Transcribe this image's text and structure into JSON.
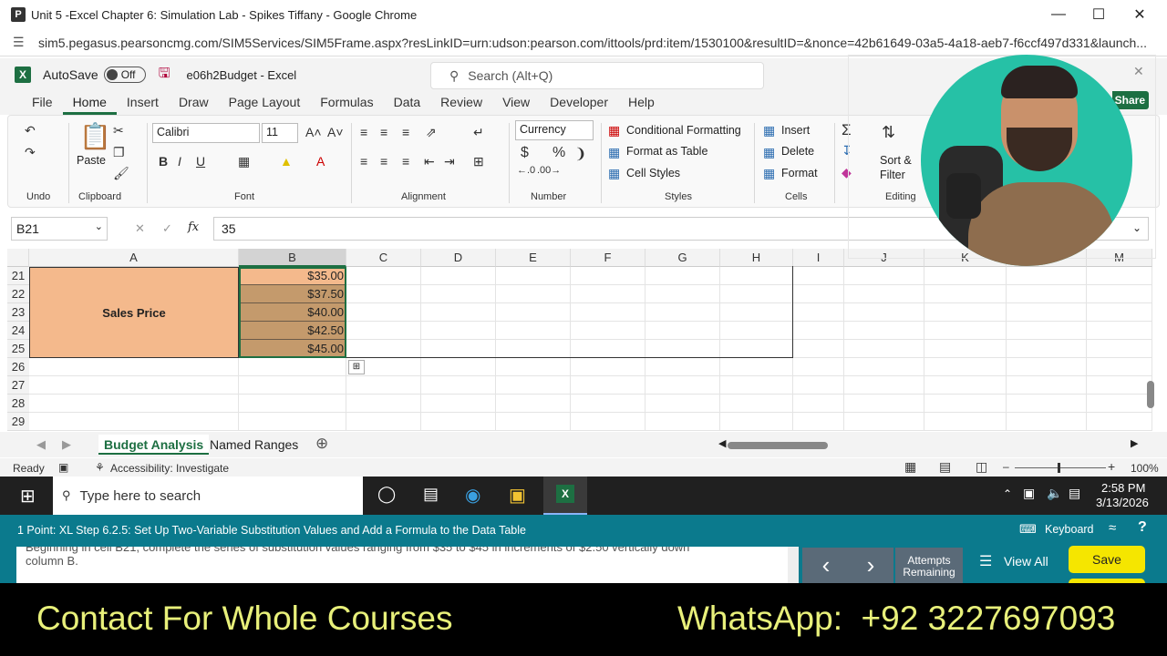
{
  "browser": {
    "title": "Unit 5 -Excel Chapter 6: Simulation Lab - Spikes Tiffany - Google Chrome",
    "icon_letter": "P",
    "url": "sim5.pegasus.pearsoncmg.com/SIM5Services/SIM5Frame.aspx?resLinkID=urn:udson:pearson.com/ittools/prd:item/1530100&resultID=&nonce=42b61649-03a5-4a18-aeb7-f6ccf497d331&launch..."
  },
  "excel": {
    "logo": "X",
    "autosave_label": "AutoSave",
    "autosave_state": "Off",
    "filename": "e06h2Budget - Excel",
    "search_placeholder": "Search (Alt+Q)",
    "share_label": "Share"
  },
  "menu_tabs": [
    "File",
    "Home",
    "Insert",
    "Draw",
    "Page Layout",
    "Formulas",
    "Data",
    "Review",
    "View",
    "Developer",
    "Help"
  ],
  "ribbon": {
    "groups": {
      "undo": "Undo",
      "clipboard": "Clipboard",
      "font": "Font",
      "alignment": "Alignment",
      "number": "Number",
      "styles": "Styles",
      "cells": "Cells",
      "editing": "Editing"
    },
    "paste": "Paste",
    "font_name": "Calibri",
    "font_size": "11",
    "number_format": "Currency",
    "conditional_formatting": "Conditional Formatting",
    "format_as_table": "Format as Table",
    "cell_styles": "Cell Styles",
    "insert": "Insert",
    "delete": "Delete",
    "format": "Format",
    "sort_filter_1": "Sort &",
    "sort_filter_2": "Filter"
  },
  "formula_bar": {
    "name_box": "B21",
    "fx": "fx",
    "value": "35"
  },
  "grid": {
    "columns": [
      "A",
      "B",
      "C",
      "D",
      "E",
      "F",
      "G",
      "H",
      "I",
      "J",
      "K",
      "L",
      "M"
    ],
    "rows": [
      "21",
      "22",
      "23",
      "24",
      "25",
      "26",
      "27",
      "28",
      "29"
    ],
    "merged_label": "Sales Price",
    "values": [
      "$35.00",
      "$37.50",
      "$40.00",
      "$42.50",
      "$45.00"
    ]
  },
  "sheets": {
    "active": "Budget Analysis",
    "other": "Named Ranges"
  },
  "status": {
    "ready": "Ready",
    "accessibility": "Accessibility: Investigate",
    "zoom": "100%"
  },
  "taskbar": {
    "search": "Type here to search",
    "time": "2:58 PM",
    "date": "3/13/2026"
  },
  "pearson": {
    "task": "1 Point: XL Step 6.2.5: Set Up Two-Variable Substitution Values and Add a Formula to the Data Table",
    "keyboard": "Keyboard",
    "instruction_1": "Beginning in cell B21, complete the series of substitution values ranging from $35 to $45 in increments of $2.50 vertically down",
    "instruction_2": "column B.",
    "attempts_1": "Attempts",
    "attempts_2": "Remaining",
    "view_all": "View All",
    "save": "Save"
  },
  "footer": {
    "left": "Contact For Whole Courses",
    "right": "WhatsApp:  +92 3227697093"
  },
  "colors": {
    "excel_green": "#1d6f42",
    "sales_fill": "#f4b98c",
    "value_fill": "#c49a6c",
    "pearson_teal": "#0b7a8d",
    "save_yellow": "#f5e600",
    "footer_text": "#e8f07a"
  }
}
